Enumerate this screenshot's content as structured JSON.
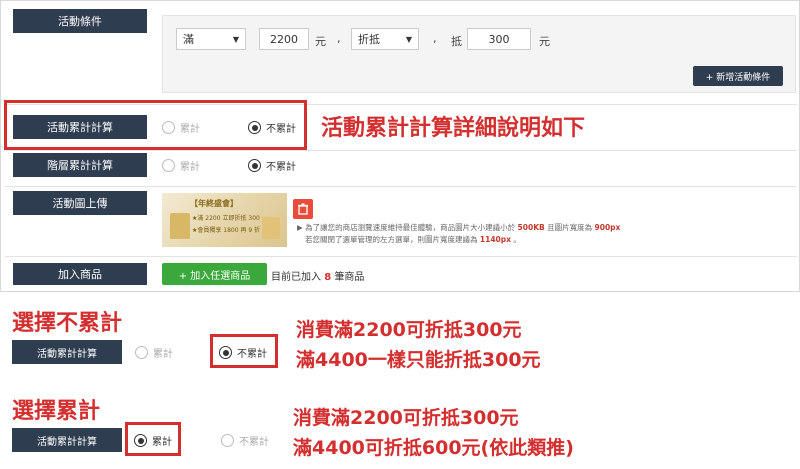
{
  "form": {
    "condition_label": "活動條件",
    "condition": {
      "type_value": "滿",
      "amount_value": "2200",
      "unit1": "元",
      "sep1": ",",
      "mode_value": "折抵",
      "sep2": ",",
      "discount_prefix": "抵",
      "discount_value": "300",
      "unit2": "元",
      "add_button": "+ 新增活動條件"
    },
    "accumulate_label": "活動累計計算",
    "accumulate_options": [
      "累計",
      "不累計"
    ],
    "accumulate_selected": "不累計",
    "tier_label": "階層累計計算",
    "tier_options": [
      "累計",
      "不累計"
    ],
    "tier_selected": "不累計",
    "image_label": "活動圖上傳",
    "banner_title": "【年終盛會】",
    "banner_line1": "★滿 2200 立即折抵 300",
    "banner_line2": "★會員獨享 1800 再 9 折",
    "hint_line1_a": "▶ 為了讓您的商店瀏覽速度維持最佳體驗，商品圖片大小建議小於",
    "hint_line1_b": "500KB",
    "hint_line1_c": "且圖片寬度為",
    "hint_line1_d": "900px",
    "hint_line2_a": "若您關閉了選單管理的左方選單，則圖片寬度建議為",
    "hint_line2_b": "1140px",
    "hint_line2_c": "。",
    "product_label": "加入商品",
    "add_product_button": "+ 加入任選商品",
    "added_prefix": "目前已加入",
    "added_count": "8",
    "added_suffix": "筆商品"
  },
  "annotations": {
    "title_note": "活動累計計算詳細說明如下",
    "no_accum_title": "選擇不累計",
    "no_accum_label": "活動累計計算",
    "no_accum_opt1": "累計",
    "no_accum_opt2": "不累計",
    "no_accum_line1": "消費滿2200可折抵300元",
    "no_accum_line2": "滿4400一樣只能折抵300元",
    "accum_title": "選擇累計",
    "accum_label": "活動累計計算",
    "accum_opt1": "累計",
    "accum_opt2": "不累計",
    "accum_line1": "消費滿2200可折抵300元",
    "accum_line2": "滿4400可折抵600元(依此類推)"
  },
  "colors": {
    "label_bg": "#2f3d50",
    "accent_red": "#d32f2f",
    "button_green": "#3aa83a"
  }
}
